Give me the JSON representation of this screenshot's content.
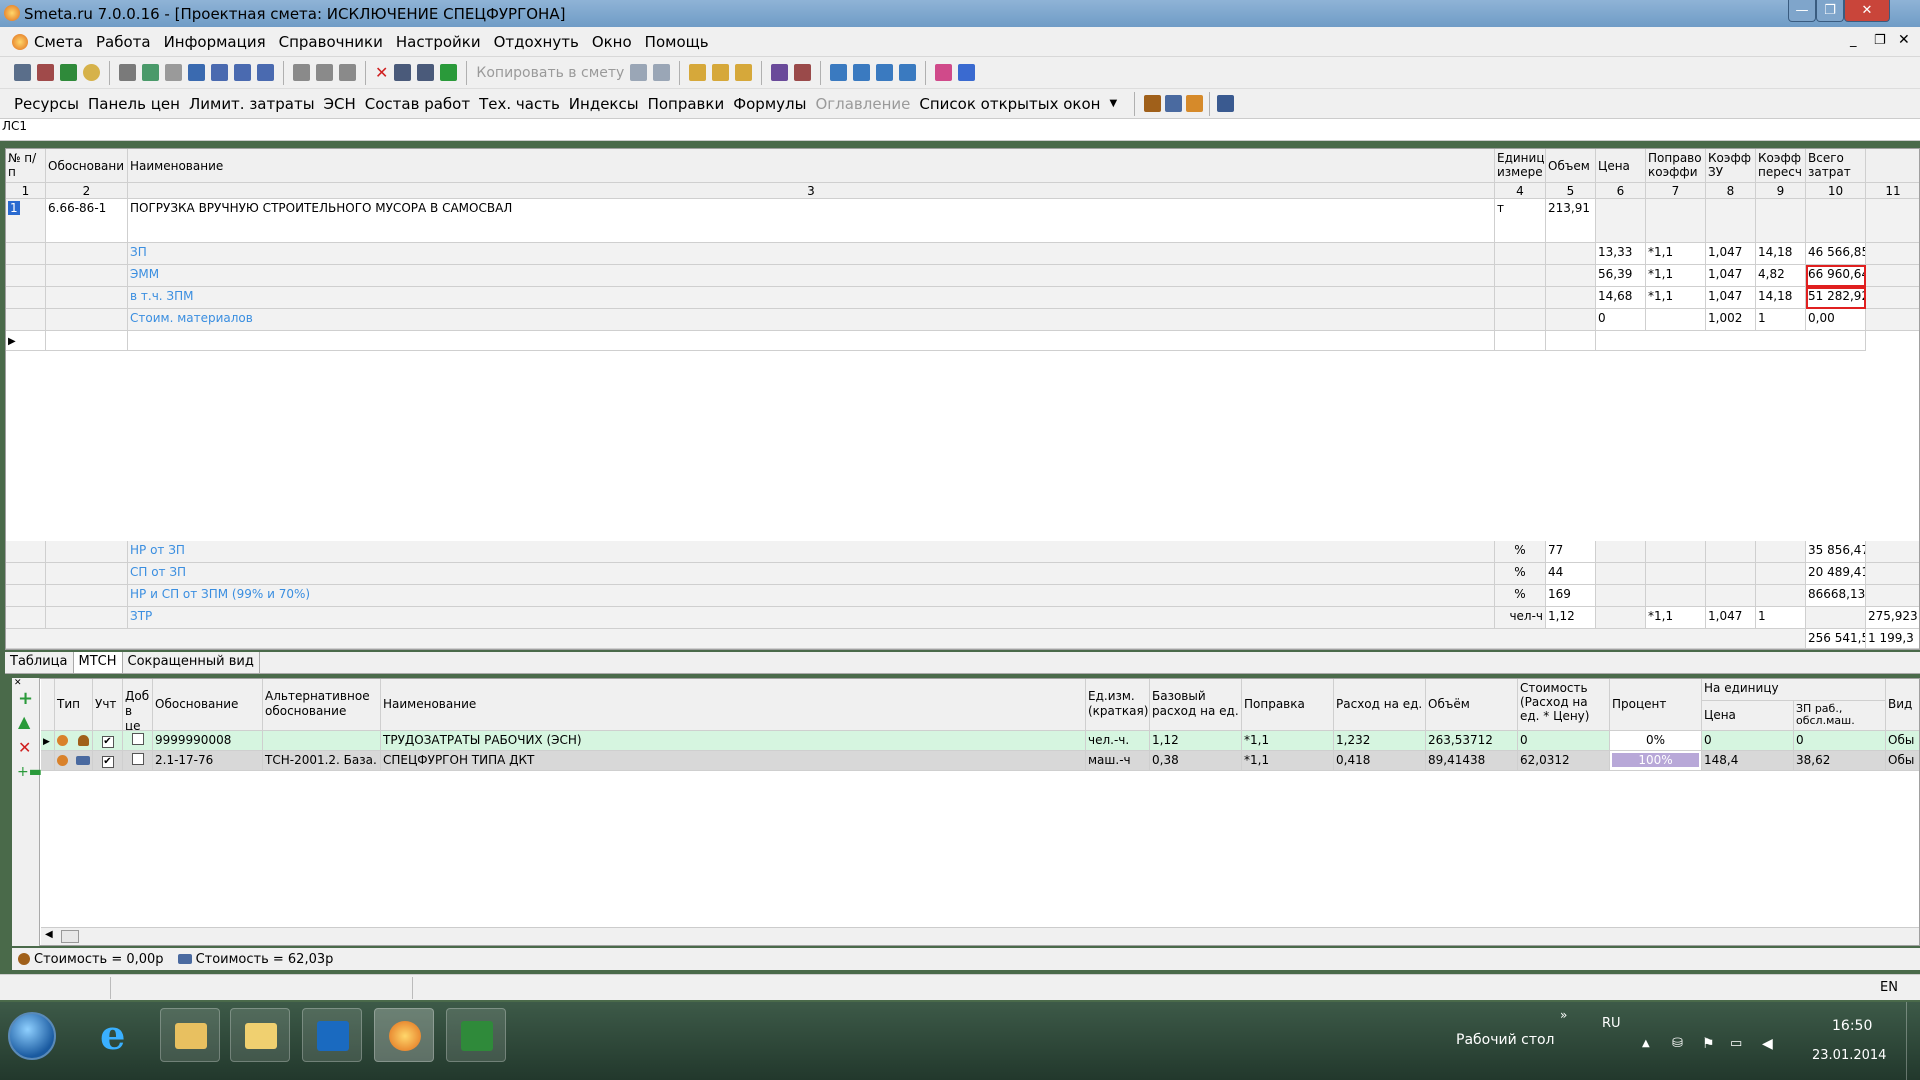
{
  "window": {
    "title": "Smeta.ru  7.0.0.16  - [Проектная смета: ИСКЛЮЧЕНИЕ СПЕЦФУРГОНА]",
    "min": "—",
    "max": "❐",
    "close": "✕"
  },
  "menu": [
    "Смета",
    "Работа",
    "Информация",
    "Справочники",
    "Настройки",
    "Отдохнуть",
    "Окно",
    "Помощь"
  ],
  "toolbar1": {
    "copy_to_estimate": "Копировать в смету"
  },
  "toolbar2": [
    "Ресурсы",
    "Панель цен",
    "Лимит. затраты",
    "ЭСН",
    "Состав работ",
    "Тех. часть",
    "Индексы",
    "Поправки",
    "Формулы"
  ],
  "toolbar2_disabled": "Оглавление",
  "toolbar2_dropdown": "Список открытых окон",
  "doc_tab": "ЛС1",
  "grid": {
    "headers": [
      "№ п/п",
      "Обосновани",
      "Наименование",
      "Единиц измере",
      "Объем",
      "Цена",
      "Поправо коэффи",
      "Коэфф ЗУ",
      "Коэфф пересч",
      "Всего затрат",
      ""
    ],
    "col_numbers": [
      "1",
      "2",
      "3",
      "4",
      "5",
      "6",
      "7",
      "8",
      "9",
      "10",
      "11"
    ],
    "main_row": {
      "num": "1",
      "code": "6.66-86-1",
      "name": "ПОГРУЗКА ВРУЧНУЮ СТРОИТЕЛЬНОГО МУСОРА В САМОСВАЛ",
      "unit": "т",
      "volume": "213,91"
    },
    "sub_rows": [
      {
        "label": "ЗП",
        "price": "13,33",
        "corr": "*1,1",
        "k_zu": "1,047",
        "k_rec": "14,18",
        "total": "46 566,85"
      },
      {
        "label": "ЭММ",
        "price": "56,39",
        "corr": "*1,1",
        "k_zu": "1,047",
        "k_rec": "4,82",
        "total": "66 960,64"
      },
      {
        "label": "в т.ч. ЗПМ",
        "price": "14,68",
        "corr": "*1,1",
        "k_zu": "1,047",
        "k_rec": "14,18",
        "total": "51 282,92"
      },
      {
        "label": "Стоим. материалов",
        "price": "0",
        "corr": "",
        "k_zu": "1,002",
        "k_rec": "1",
        "total": "0,00"
      }
    ],
    "footer_rows": [
      {
        "label": "НР от ЗП",
        "unit": "%",
        "volume": "77",
        "corr": "",
        "k_zu": "",
        "k_rec": "",
        "total": "35 856,47",
        "c11": ""
      },
      {
        "label": "СП от ЗП",
        "unit": "%",
        "volume": "44",
        "corr": "",
        "k_zu": "",
        "k_rec": "",
        "total": "20 489,41",
        "c11": ""
      },
      {
        "label": "НР и СП от ЗПМ (99% и 70%)",
        "unit": "%",
        "volume": "169",
        "corr": "",
        "k_zu": "",
        "k_rec": "",
        "total": "86668,13",
        "c11": ""
      },
      {
        "label": "ЗТР",
        "unit": "чел-ч",
        "volume": "1,12",
        "corr": "*1,1",
        "k_zu": "1,047",
        "k_rec": "1",
        "total": "",
        "c11": "275,923"
      }
    ],
    "totals": {
      "total": "256 541,5",
      "c11": "1 199,3"
    }
  },
  "bottom_tabs": [
    "Таблица",
    "МТСН",
    "Сокращенный вид"
  ],
  "lower": {
    "headers": [
      "Тип",
      "Учт",
      "Доб в це",
      "Обоснование",
      "Альтернативное обоснование",
      "Наименование",
      "Ед.изм. (краткая)",
      "Базовый расход на ед.",
      "Поправка",
      "Расход на ед.",
      "Объём",
      "Стоимость (Расход на ед. * Цену)",
      "Процент",
      "Цена",
      "ЗП раб., обсл.маш.",
      "Вид"
    ],
    "group_header": "На единицу",
    "rows": [
      {
        "code": "9999990008",
        "alt": "",
        "name": "ТРУДОЗАТРАТЫ РАБОЧИХ (ЭСН)",
        "unit": "чел.-ч.",
        "base": "1,12",
        "corr": "*1,1",
        "rate": "1,232",
        "vol": "263,53712",
        "cost": "0",
        "pct": "0%",
        "price": "0",
        "zp": "0",
        "kind": "Обы"
      },
      {
        "code": "2.1-17-76",
        "alt": "ТСН-2001.2. База.",
        "name": "СПЕЦФУРГОН ТИПА ДКТ",
        "unit": "маш.-ч",
        "base": "0,38",
        "corr": "*1,1",
        "rate": "0,418",
        "vol": "89,41438",
        "cost": "62,0312",
        "pct": "100%",
        "price": "148,4",
        "zp": "38,62",
        "kind": "Обы"
      }
    ]
  },
  "costs": [
    "Стоимость = 0,00р",
    "Стоимость = 62,03р"
  ],
  "status_lang": "EN",
  "taskbar": {
    "desktop": "Рабочий стол",
    "lang": "RU",
    "time": "16:50",
    "date": "23.01.2014"
  }
}
